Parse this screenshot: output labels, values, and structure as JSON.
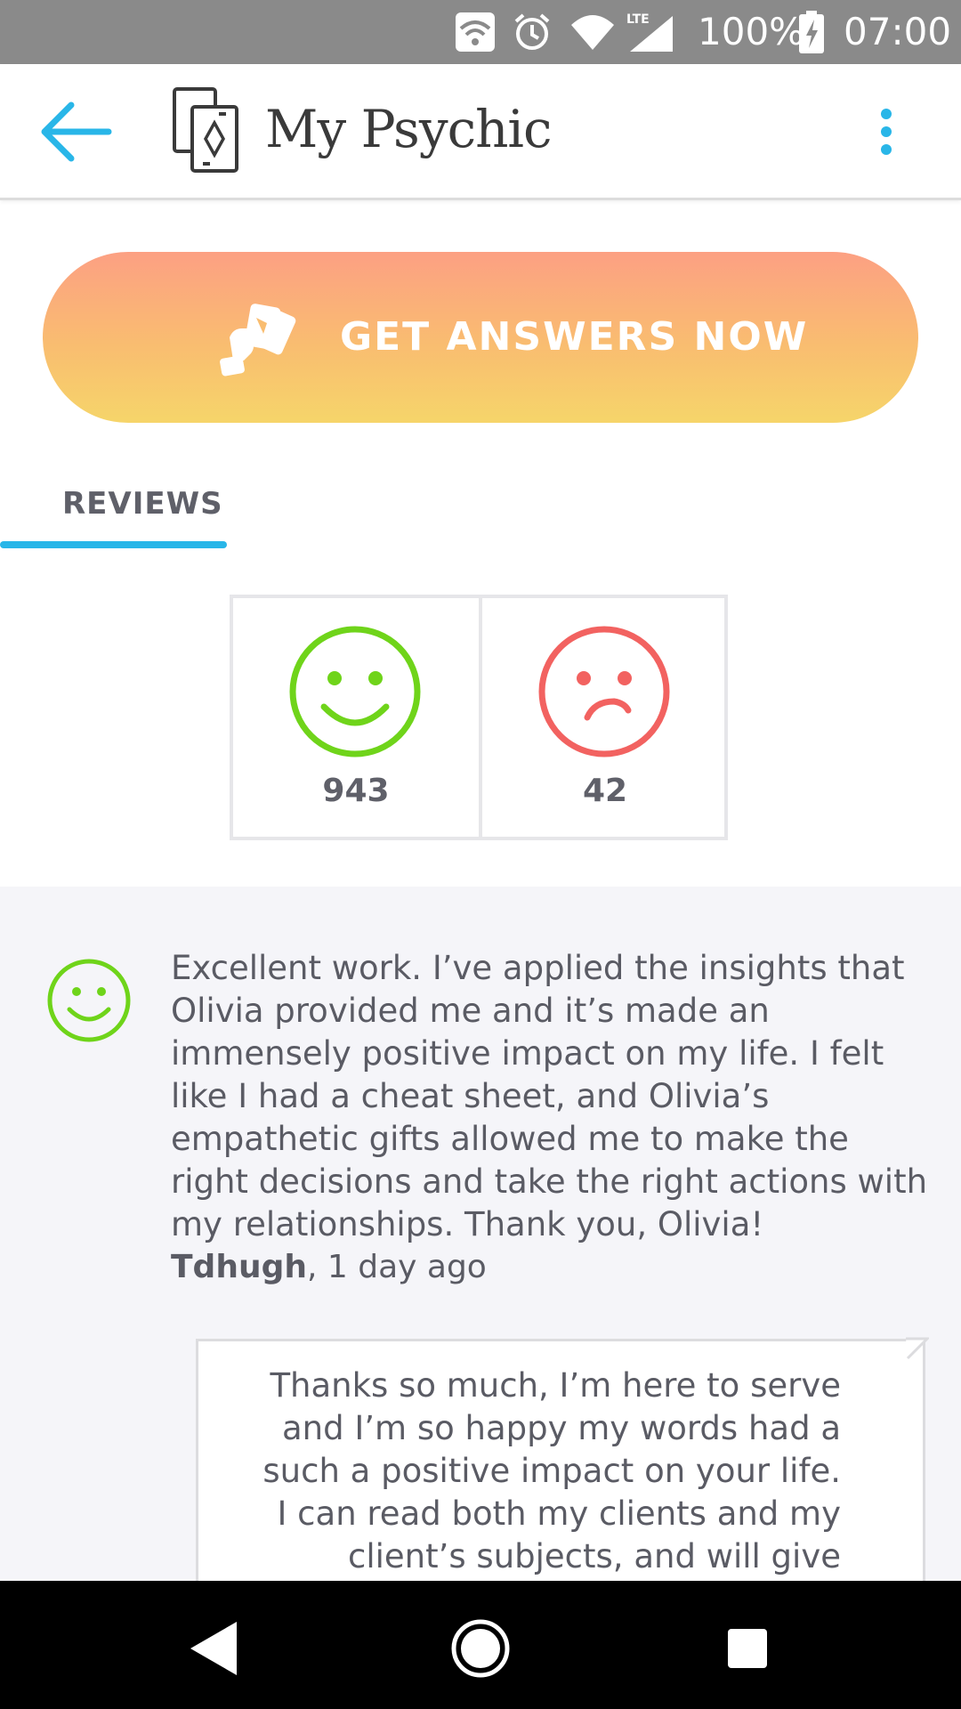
{
  "status_bar": {
    "battery": "100%",
    "time": "07:00",
    "network": "LTE",
    "icons": [
      "wifi-hotspot-icon",
      "alarm-icon",
      "wifi-icon",
      "lte-signal-icon",
      "battery-charging-icon"
    ]
  },
  "app_bar": {
    "title": "My Psychic",
    "back_icon": "arrow-left-icon",
    "logo_icon": "cards-logo-icon",
    "menu_icon": "more-vert-icon",
    "accent": "#29b6e8"
  },
  "cta": {
    "label": "GET ANSWERS NOW",
    "icon": "hand-cards-icon",
    "gradient_top": "#fca083",
    "gradient_bottom": "#f6d56a"
  },
  "tabs": [
    {
      "label": "REVIEWS",
      "active": true
    }
  ],
  "ratings": {
    "positive_count": "943",
    "negative_count": "42",
    "positive_color": "#6fd41a",
    "negative_color": "#f26260"
  },
  "reviews": [
    {
      "sentiment": "positive",
      "text": "Excellent work. I’ve applied the insights that Olivia provided me and it’s made an immensely positive impact on my life. I felt like I had a cheat sheet, and Olivia’s empathetic gifts allowed me to make the right decisions and take the right actions with my relationships. Thank you, Olivia!",
      "author": "Tdhugh",
      "time": ", 1 day ago",
      "reply": "Thanks so much, I’m here to serve and I’m so happy my words had a such a positive impact on your life. I can read both my clients and my client’s subjects, and will give"
    }
  ],
  "nav_bar": {
    "back": "nav-back-icon",
    "home": "nav-home-icon",
    "recents": "nav-recents-icon"
  }
}
